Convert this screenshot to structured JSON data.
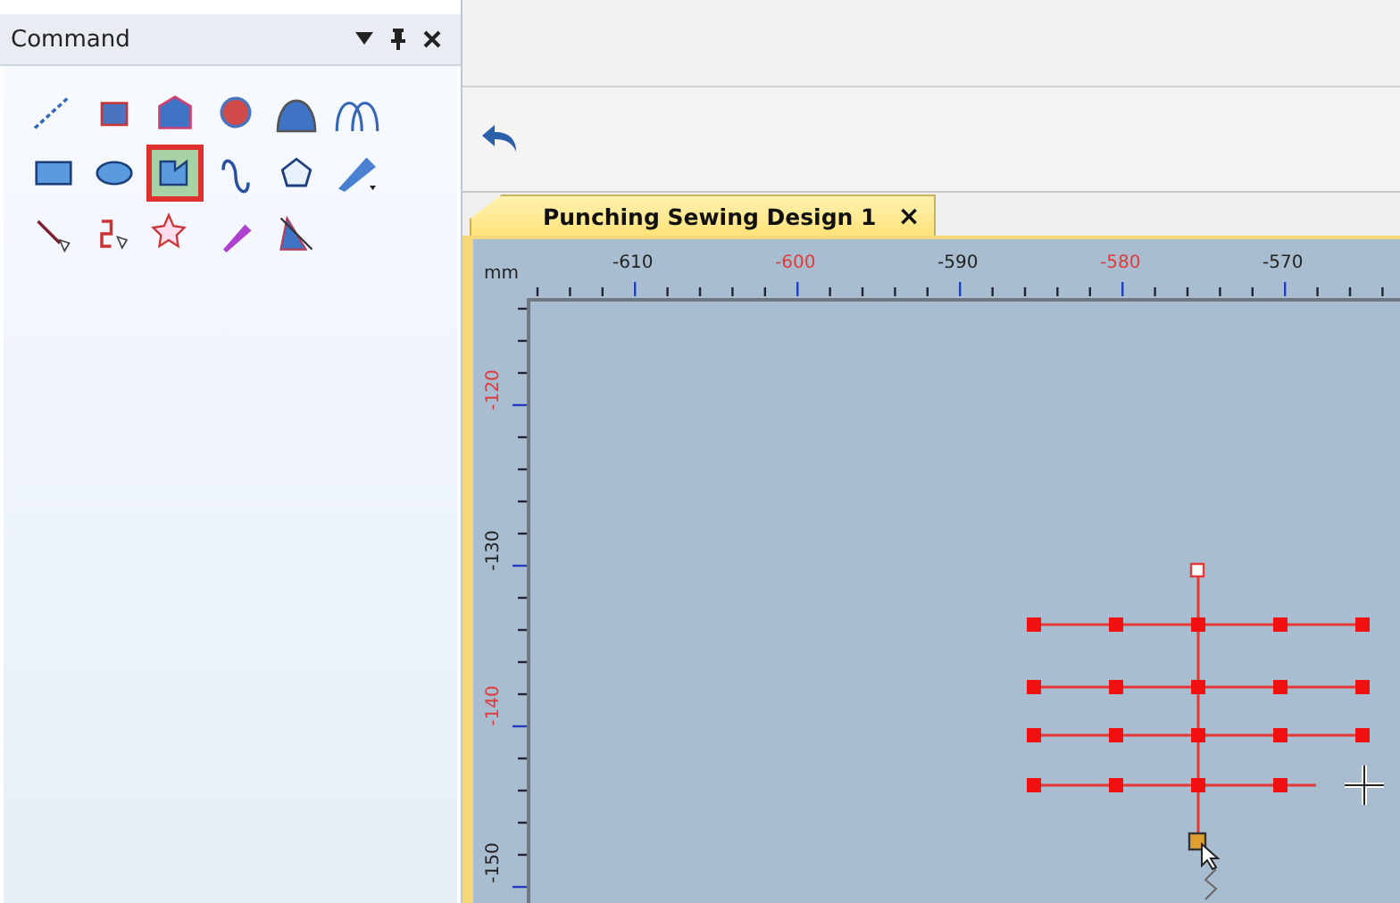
{
  "panel": {
    "title": "Command",
    "tools": [
      {
        "selected": false
      },
      {
        "selected": false
      },
      {
        "selected": false
      },
      {
        "selected": false
      },
      {
        "selected": false
      },
      {
        "selected": false
      },
      {
        "selected": false
      },
      {
        "selected": false
      },
      {
        "selected": true
      },
      {
        "selected": false
      },
      {
        "selected": false
      },
      {
        "selected": false
      },
      {
        "selected": false
      },
      {
        "selected": false
      },
      {
        "selected": false
      },
      {
        "selected": false
      },
      {
        "selected": false
      }
    ]
  },
  "document_tab": {
    "label": "Punching Sewing Design 1",
    "close": "×",
    "selected": true
  },
  "ruler": {
    "unit": "mm",
    "x_labels": [
      {
        "text": "-610",
        "highlighted": false
      },
      {
        "text": "-600",
        "highlighted": true
      },
      {
        "text": "-590",
        "highlighted": false
      },
      {
        "text": "-580",
        "highlighted": true
      },
      {
        "text": "-570",
        "highlighted": false
      }
    ],
    "y_labels": [
      {
        "text": "-120",
        "highlighted": true
      },
      {
        "text": "-130",
        "highlighted": false
      },
      {
        "text": "-140",
        "highlighted": true
      },
      {
        "text": "-150",
        "highlighted": false
      }
    ]
  }
}
